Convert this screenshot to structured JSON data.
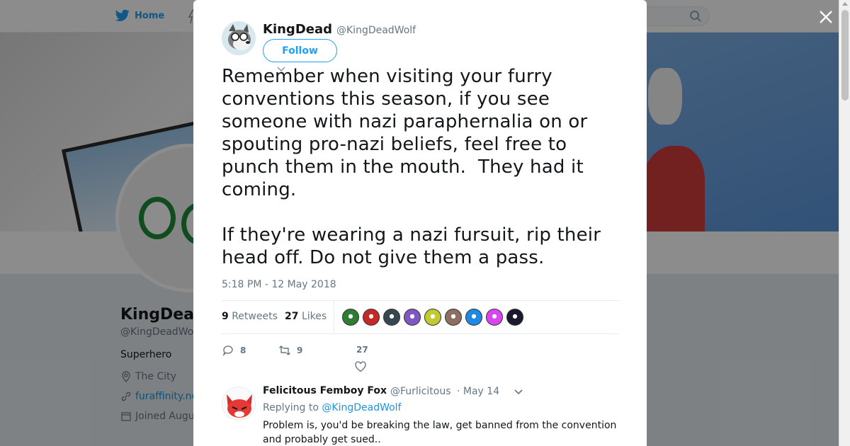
{
  "background_page": {
    "nav": {
      "home_label": "Home"
    },
    "profile": {
      "name": "KingDead",
      "handle": "@KingDeadWo",
      "bio": "Superhero",
      "location": "The City",
      "website": "furaffinity.ne",
      "joined": "Joined Augu"
    }
  },
  "tweet": {
    "author_name": "KingDead",
    "author_handle": "@KingDeadWolf",
    "follow_label": "Follow",
    "text": "Remember when visiting your furry\nconventions this season, if you see\nsomeone with nazi paraphernalia on or\nspouting pro-nazi beliefs, feel free to\npunch them in the mouth.  They had it\ncoming.\n\nIf they're wearing a nazi fursuit, rip their\nhead off. Do not give them a pass.",
    "timestamp": "5:18 PM - 12 May 2018",
    "retweets_count": "9",
    "retweets_label": "Retweets",
    "likes_count": "27",
    "likes_label": "Likes",
    "liker_colors": [
      "#2e7d32",
      "#c62828",
      "#37474f",
      "#7e57c2",
      "#c0ca33",
      "#8d6e63",
      "#1e88e5",
      "#d946ef",
      "#1a1a2e"
    ],
    "actions": {
      "reply_count": "8",
      "retweet_count": "9",
      "like_count": "27"
    }
  },
  "reply": {
    "name": "Felicitous Femboy Fox",
    "handle": "@Furlicitous",
    "date": "· May 14",
    "replying_prefix": "Replying to",
    "replying_to": "@KingDeadWolf",
    "text": "Problem is, you'd be breaking the law, get banned from the convention and probably get sued.."
  },
  "colors": {
    "twitter_blue": "#1da1f2",
    "text_primary": "#14171a",
    "text_secondary": "#657786",
    "overlay": "rgba(0,0,0,0.45)"
  }
}
